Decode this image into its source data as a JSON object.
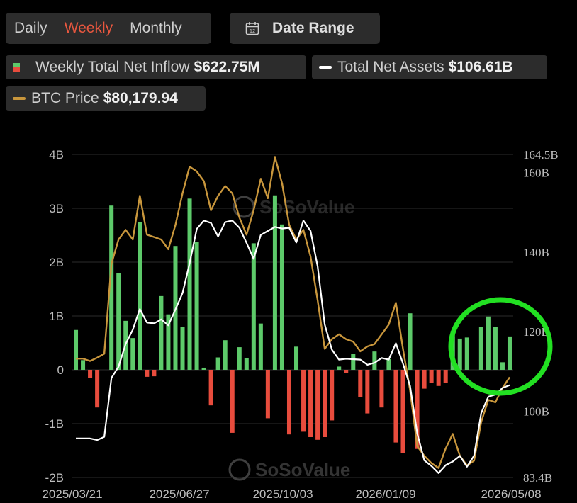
{
  "tabs": [
    {
      "label": "Daily"
    },
    {
      "label": "Weekly",
      "active": true
    },
    {
      "label": "Monthly"
    }
  ],
  "date_range": {
    "label": "Date Range",
    "icon": "calendar-icon",
    "icon_text": "12"
  },
  "legend": {
    "inflow": {
      "label": "Weekly Total Net Inflow",
      "value": "$622.75M"
    },
    "assets": {
      "label": "Total Net Assets",
      "value": "$106.61B"
    },
    "btc": {
      "label": "BTC Price",
      "value": "$80,179.94"
    }
  },
  "watermark": "SoSoValue",
  "colors": {
    "positive": "#5dca6a",
    "negative": "#e84c3d",
    "assets_line": "#ffffff",
    "btc_line": "#c8963c",
    "highlight": "#22e022",
    "grid": "#2b2b2b"
  },
  "chart_data": {
    "type": "bar",
    "left_axis": {
      "ticks": [
        "4B",
        "3B",
        "2B",
        "1B",
        "0",
        "-1B",
        "-2B"
      ],
      "range": [
        -2,
        4
      ],
      "unit": "B"
    },
    "right_axis": {
      "ticks": [
        "164.5B",
        "160B",
        "140B",
        "120B",
        "100B",
        "83.4B"
      ],
      "range": [
        83.4,
        164.5
      ],
      "unit": "B"
    },
    "x_labels": [
      "2025/03/21",
      "2025/06/27",
      "2025/10/03",
      "2026/01/09",
      "2026/05/08"
    ],
    "series": [
      {
        "name": "Weekly Total Net Inflow",
        "values": [
          0.74,
          0.18,
          -0.15,
          -0.7,
          0,
          3.05,
          1.79,
          0.91,
          0.59,
          2.74,
          -0.13,
          -0.12,
          1.37,
          1.03,
          2.3,
          0.79,
          3.18,
          2.37,
          0.04,
          -0.66,
          0.23,
          0.55,
          -1.17,
          0.42,
          0.22,
          2.35,
          0.86,
          -0.9,
          3.24,
          2.7,
          -1.2,
          0.43,
          -1.15,
          -1.25,
          -1.3,
          -1.25,
          -0.94,
          0.06,
          -0.06,
          0.29,
          -0.5,
          -0.81,
          0.34,
          -0.7,
          0.2,
          -1.35,
          -1.54,
          1.05,
          -1.47,
          -0.35,
          -0.25,
          -0.3,
          -0.25,
          0.72,
          0.58,
          0.6,
          0,
          0.79,
          0.99,
          0.8,
          0.14,
          0.62
        ]
      },
      {
        "name": "Total Net Assets",
        "values": [
          93.2,
          93.2,
          93.2,
          92.8,
          93.6,
          108.4,
          111.2,
          116.9,
          120.5,
          125.7,
          122.3,
          122.1,
          123.1,
          121.6,
          125.6,
          129.7,
          137.2,
          145.8,
          147.9,
          147.3,
          143.9,
          147.5,
          147.9,
          146.1,
          142.3,
          138.3,
          144.3,
          145.3,
          146.3,
          145.9,
          146.1,
          142.4,
          147.9,
          145.3,
          136.4,
          121.8,
          115.5,
          113.0,
          113.2,
          113.1,
          113.0,
          111.7,
          112.2,
          113.4,
          113.0,
          117.1,
          112.0,
          106.4,
          94.5,
          87.7,
          86.3,
          84.5,
          86.5,
          87.4,
          88.8,
          86.1,
          88.9,
          99.6,
          103.7,
          104.2,
          105.9,
          106.6
        ]
      },
      {
        "name": "BTC Price",
        "values": [
          84000,
          84000,
          83500,
          84200,
          85000,
          103500,
          108500,
          110500,
          108500,
          117500,
          109500,
          109000,
          108500,
          106500,
          111500,
          118000,
          123500,
          122500,
          120500,
          114500,
          117500,
          119500,
          118000,
          113000,
          109500,
          114500,
          121000,
          117000,
          125500,
          120000,
          111500,
          108500,
          110500,
          105000,
          96000,
          86000,
          88000,
          89000,
          88000,
          87500,
          85500,
          86500,
          87000,
          89000,
          91000,
          95500,
          86000,
          77500,
          66000,
          64000,
          62500,
          61500,
          65500,
          68500,
          64000,
          62000,
          63000,
          71000,
          75500,
          75000,
          78000,
          80180
        ]
      }
    ],
    "btc_axis_range": [
      61000,
      126000
    ],
    "grid": true,
    "annotation": "green circle around final weeks"
  }
}
